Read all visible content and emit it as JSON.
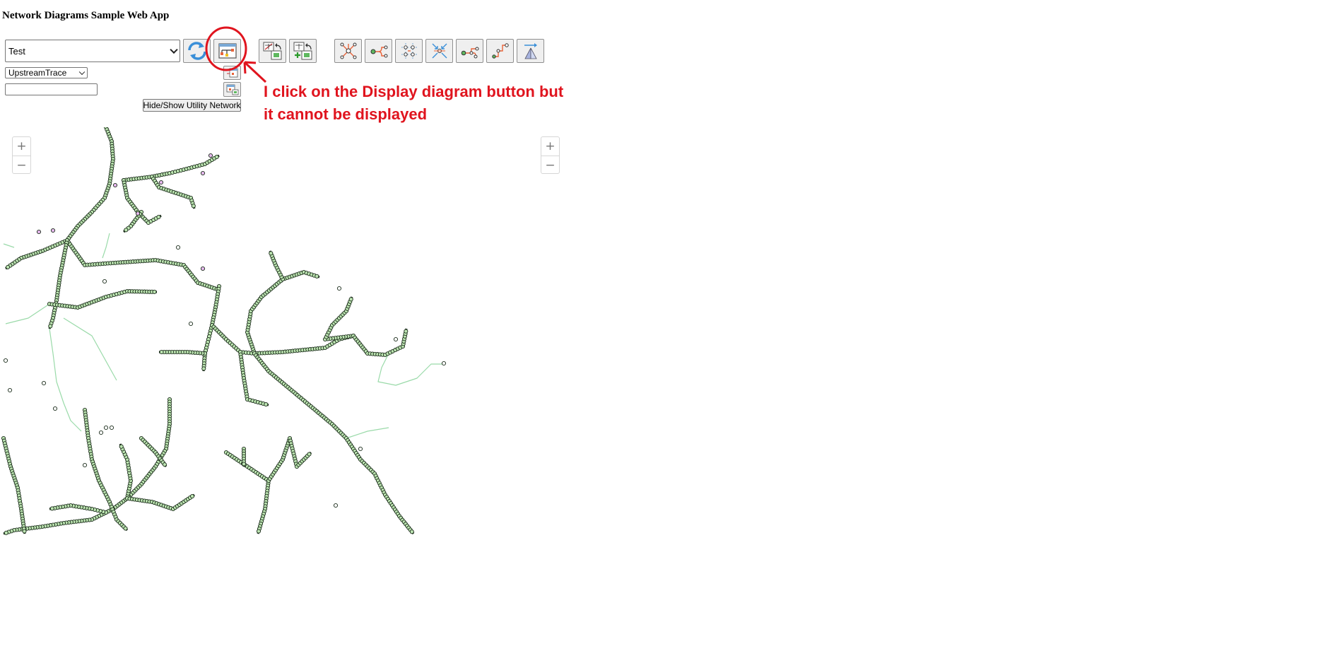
{
  "app": {
    "title": "Network Diagrams Sample Web App"
  },
  "controls": {
    "diagram_template": {
      "selected": "Test"
    },
    "trace_type": {
      "selected": "UpstreamTrace"
    },
    "text_input": {
      "value": ""
    },
    "hide_show_label": "Hide/Show Utility Network"
  },
  "toolbar": {
    "left_buttons": [
      "refresh-icon",
      "display-diagram-icon"
    ],
    "edit_buttons": [
      "overwrite-diagram-icon",
      "append-diagram-icon"
    ],
    "layout_buttons": [
      "radial-layout-icon",
      "tree-layout-icon",
      "grid-layout-icon",
      "compress-layout-icon",
      "smart-tree-layout-icon",
      "linear-dispatch-layout-icon",
      "mainline-tree-layout-icon"
    ],
    "small_buttons": [
      "add-to-diagram-icon",
      "extend-diagram-icon"
    ]
  },
  "map": {
    "zoom_in_label": "+",
    "zoom_out_label": "−",
    "line_color": "#1a2b1a",
    "node_fill": "#bde5b2",
    "link_color": "#8fd6a0",
    "highlight_node_fill": "#e7b9ef"
  },
  "annotation": {
    "text": "I click on the Display diagram button but it cannot be displayed",
    "color": "#e0141e"
  }
}
